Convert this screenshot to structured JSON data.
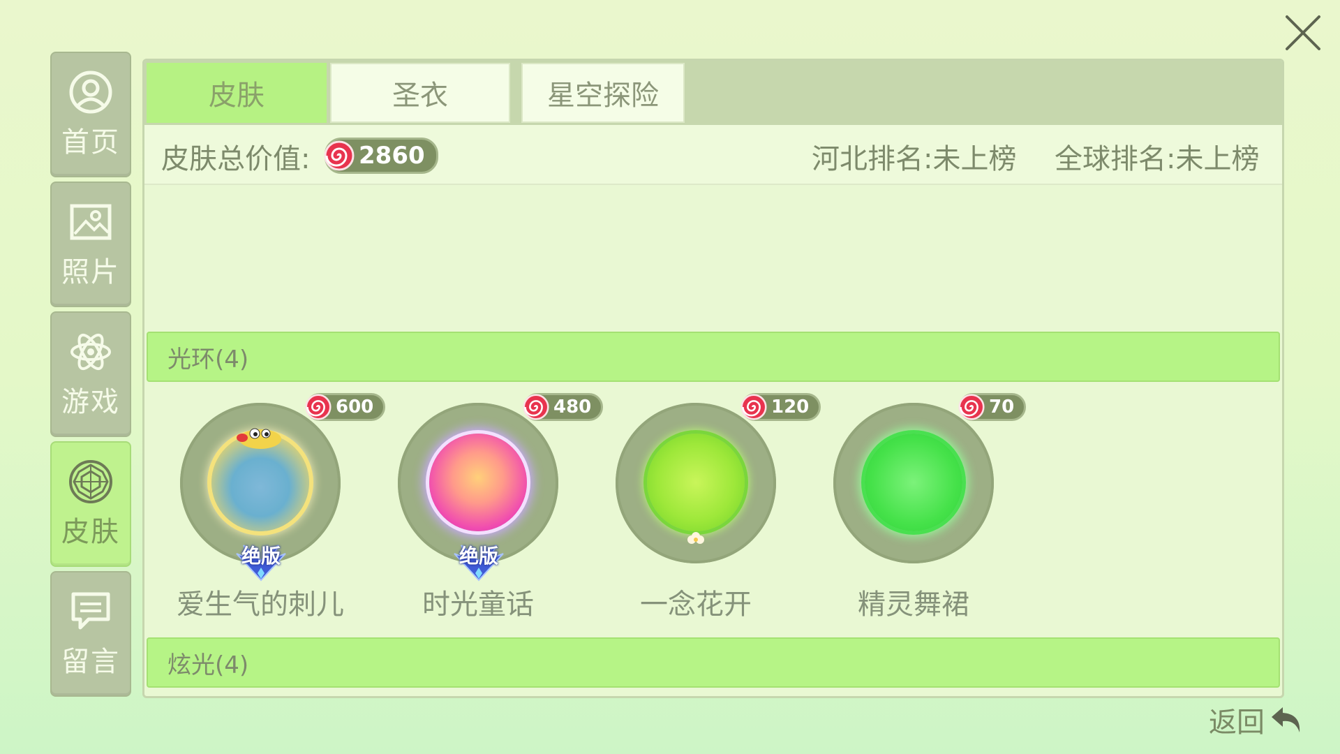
{
  "sidebar": {
    "items": [
      {
        "label": "首页",
        "icon": "user-circle-icon"
      },
      {
        "label": "照片",
        "icon": "photo-icon"
      },
      {
        "label": "游戏",
        "icon": "atom-icon"
      },
      {
        "label": "皮肤",
        "icon": "gem-icon",
        "active": true
      },
      {
        "label": "留言",
        "icon": "message-icon"
      }
    ]
  },
  "tabs": [
    {
      "label": "皮肤",
      "active": true
    },
    {
      "label": "圣衣"
    },
    {
      "label": "星空探险"
    }
  ],
  "stats": {
    "total_label": "皮肤总价值:",
    "total_value": "2860",
    "province_rank": "河北排名:未上榜",
    "global_rank": "全球排名:未上榜"
  },
  "sections": {
    "halo_title": "光环(4)",
    "glow_title": "炫光(4)"
  },
  "halo_items": [
    {
      "name": "爱生气的刺儿",
      "price": "600",
      "badge": "绝版"
    },
    {
      "name": "时光童话",
      "price": "480",
      "badge": "绝版"
    },
    {
      "name": "一念花开",
      "price": "120"
    },
    {
      "name": "精灵舞裙",
      "price": "70"
    }
  ],
  "back_label": "返回",
  "colors": {
    "accent_green": "#b6f283",
    "sidebar_bg": "#b7c5a2",
    "coin_red": "#e8334e"
  }
}
